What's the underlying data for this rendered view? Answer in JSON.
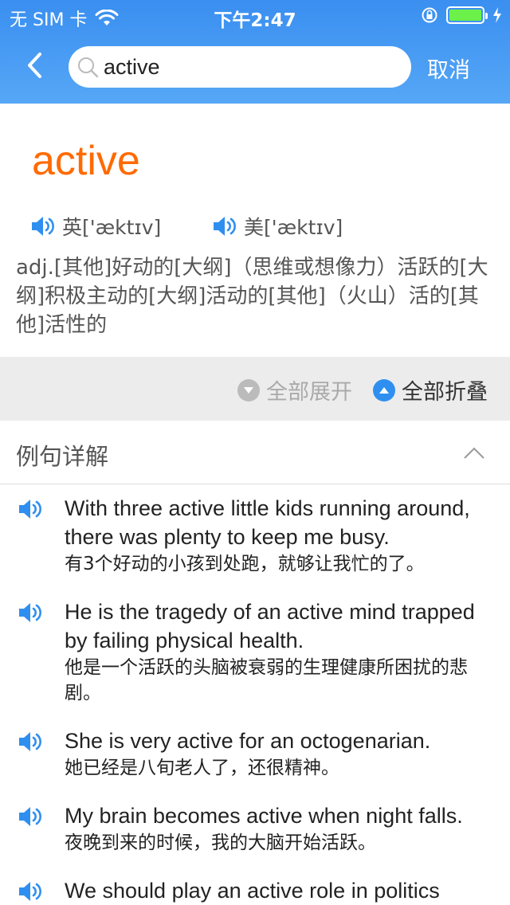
{
  "status_bar": {
    "carrier": "无 SIM 卡",
    "time": "下午2:47",
    "battery_level": 1.0
  },
  "search": {
    "value": "active",
    "cancel_label": "取消"
  },
  "word": {
    "headword": "active",
    "pron_uk": "英['æktɪv]",
    "pron_us": "美['æktɪv]",
    "definition": "adj.[其他]好动的[大纲]（思维或想像力）活跃的[大纲]积极主动的[大纲]活动的[其他]（火山）活的[其他]活性的"
  },
  "toggles": {
    "expand_all": "全部展开",
    "collapse_all": "全部折叠"
  },
  "examples_section": {
    "title": "例句详解",
    "items": [
      {
        "en": "With three active little kids running around, there was plenty to keep me busy.",
        "zh": "有3个好动的小孩到处跑，就够让我忙的了。"
      },
      {
        "en": "He is the tragedy of an active mind trapped by failing physical health.",
        "zh": "他是一个活跃的头脑被衰弱的生理健康所困扰的悲剧。"
      },
      {
        "en": "She is very active for an octogenarian.",
        "zh": "她已经是八旬老人了，还很精神。"
      },
      {
        "en": "My brain becomes active when night falls.",
        "zh": "夜晚到来的时候，我的大脑开始活跃。"
      },
      {
        "en": "We should play an active role in politics",
        "zh": ""
      }
    ]
  },
  "colors": {
    "header_blue": "#3a8ff0",
    "headword_orange": "#ff6a00",
    "speaker_blue": "#2f8ff0"
  }
}
